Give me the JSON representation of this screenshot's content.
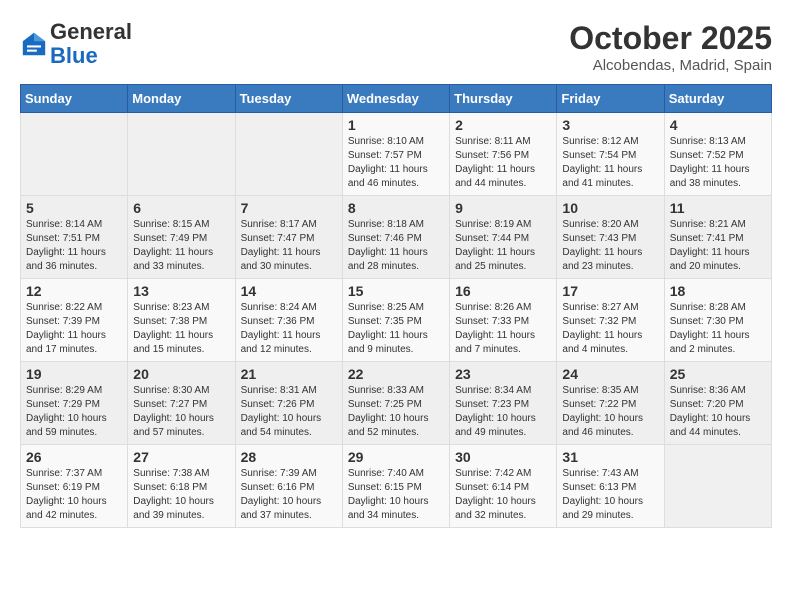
{
  "header": {
    "logo_general": "General",
    "logo_blue": "Blue",
    "month_title": "October 2025",
    "location": "Alcobendas, Madrid, Spain"
  },
  "weekdays": [
    "Sunday",
    "Monday",
    "Tuesday",
    "Wednesday",
    "Thursday",
    "Friday",
    "Saturday"
  ],
  "weeks": [
    [
      {
        "day": "",
        "info": ""
      },
      {
        "day": "",
        "info": ""
      },
      {
        "day": "",
        "info": ""
      },
      {
        "day": "1",
        "info": "Sunrise: 8:10 AM\nSunset: 7:57 PM\nDaylight: 11 hours and 46 minutes."
      },
      {
        "day": "2",
        "info": "Sunrise: 8:11 AM\nSunset: 7:56 PM\nDaylight: 11 hours and 44 minutes."
      },
      {
        "day": "3",
        "info": "Sunrise: 8:12 AM\nSunset: 7:54 PM\nDaylight: 11 hours and 41 minutes."
      },
      {
        "day": "4",
        "info": "Sunrise: 8:13 AM\nSunset: 7:52 PM\nDaylight: 11 hours and 38 minutes."
      }
    ],
    [
      {
        "day": "5",
        "info": "Sunrise: 8:14 AM\nSunset: 7:51 PM\nDaylight: 11 hours and 36 minutes."
      },
      {
        "day": "6",
        "info": "Sunrise: 8:15 AM\nSunset: 7:49 PM\nDaylight: 11 hours and 33 minutes."
      },
      {
        "day": "7",
        "info": "Sunrise: 8:17 AM\nSunset: 7:47 PM\nDaylight: 11 hours and 30 minutes."
      },
      {
        "day": "8",
        "info": "Sunrise: 8:18 AM\nSunset: 7:46 PM\nDaylight: 11 hours and 28 minutes."
      },
      {
        "day": "9",
        "info": "Sunrise: 8:19 AM\nSunset: 7:44 PM\nDaylight: 11 hours and 25 minutes."
      },
      {
        "day": "10",
        "info": "Sunrise: 8:20 AM\nSunset: 7:43 PM\nDaylight: 11 hours and 23 minutes."
      },
      {
        "day": "11",
        "info": "Sunrise: 8:21 AM\nSunset: 7:41 PM\nDaylight: 11 hours and 20 minutes."
      }
    ],
    [
      {
        "day": "12",
        "info": "Sunrise: 8:22 AM\nSunset: 7:39 PM\nDaylight: 11 hours and 17 minutes."
      },
      {
        "day": "13",
        "info": "Sunrise: 8:23 AM\nSunset: 7:38 PM\nDaylight: 11 hours and 15 minutes."
      },
      {
        "day": "14",
        "info": "Sunrise: 8:24 AM\nSunset: 7:36 PM\nDaylight: 11 hours and 12 minutes."
      },
      {
        "day": "15",
        "info": "Sunrise: 8:25 AM\nSunset: 7:35 PM\nDaylight: 11 hours and 9 minutes."
      },
      {
        "day": "16",
        "info": "Sunrise: 8:26 AM\nSunset: 7:33 PM\nDaylight: 11 hours and 7 minutes."
      },
      {
        "day": "17",
        "info": "Sunrise: 8:27 AM\nSunset: 7:32 PM\nDaylight: 11 hours and 4 minutes."
      },
      {
        "day": "18",
        "info": "Sunrise: 8:28 AM\nSunset: 7:30 PM\nDaylight: 11 hours and 2 minutes."
      }
    ],
    [
      {
        "day": "19",
        "info": "Sunrise: 8:29 AM\nSunset: 7:29 PM\nDaylight: 10 hours and 59 minutes."
      },
      {
        "day": "20",
        "info": "Sunrise: 8:30 AM\nSunset: 7:27 PM\nDaylight: 10 hours and 57 minutes."
      },
      {
        "day": "21",
        "info": "Sunrise: 8:31 AM\nSunset: 7:26 PM\nDaylight: 10 hours and 54 minutes."
      },
      {
        "day": "22",
        "info": "Sunrise: 8:33 AM\nSunset: 7:25 PM\nDaylight: 10 hours and 52 minutes."
      },
      {
        "day": "23",
        "info": "Sunrise: 8:34 AM\nSunset: 7:23 PM\nDaylight: 10 hours and 49 minutes."
      },
      {
        "day": "24",
        "info": "Sunrise: 8:35 AM\nSunset: 7:22 PM\nDaylight: 10 hours and 46 minutes."
      },
      {
        "day": "25",
        "info": "Sunrise: 8:36 AM\nSunset: 7:20 PM\nDaylight: 10 hours and 44 minutes."
      }
    ],
    [
      {
        "day": "26",
        "info": "Sunrise: 7:37 AM\nSunset: 6:19 PM\nDaylight: 10 hours and 42 minutes."
      },
      {
        "day": "27",
        "info": "Sunrise: 7:38 AM\nSunset: 6:18 PM\nDaylight: 10 hours and 39 minutes."
      },
      {
        "day": "28",
        "info": "Sunrise: 7:39 AM\nSunset: 6:16 PM\nDaylight: 10 hours and 37 minutes."
      },
      {
        "day": "29",
        "info": "Sunrise: 7:40 AM\nSunset: 6:15 PM\nDaylight: 10 hours and 34 minutes."
      },
      {
        "day": "30",
        "info": "Sunrise: 7:42 AM\nSunset: 6:14 PM\nDaylight: 10 hours and 32 minutes."
      },
      {
        "day": "31",
        "info": "Sunrise: 7:43 AM\nSunset: 6:13 PM\nDaylight: 10 hours and 29 minutes."
      },
      {
        "day": "",
        "info": ""
      }
    ]
  ]
}
